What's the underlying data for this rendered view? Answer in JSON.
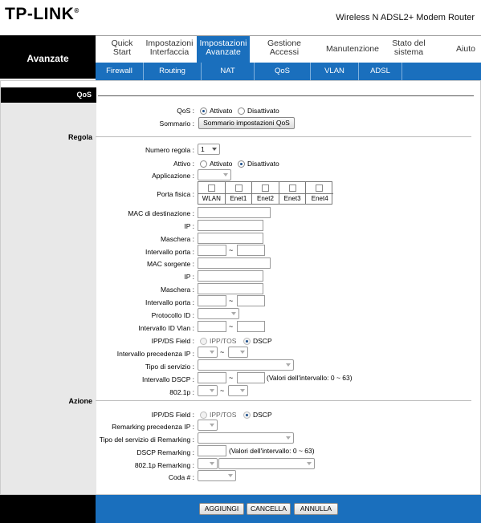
{
  "header": {
    "logo_text": "TP-LINK",
    "logo_mark": "®",
    "model": "Wireless N ADSL2+ Modem Router"
  },
  "left_section": {
    "label": "Avanzate"
  },
  "menu": {
    "items": [
      {
        "line1": "Quick",
        "line2": "Start"
      },
      {
        "line1": "Impostazioni",
        "line2": "Interfaccia"
      },
      {
        "line1": "Impostazioni",
        "line2": "Avanzate"
      },
      {
        "line1": "Gestione",
        "line2": "Accessi"
      },
      {
        "line1": "Manutenzione",
        "line2": ""
      },
      {
        "line1": "Stato del",
        "line2": "sistema"
      },
      {
        "line1": "Aiuto",
        "line2": ""
      }
    ],
    "active": "Impostazioni Avanzate"
  },
  "submenu": {
    "items": [
      "Firewall",
      "Routing",
      "NAT",
      "QoS",
      "VLAN",
      "ADSL"
    ],
    "active": "QoS"
  },
  "qos_section": {
    "title": "QoS",
    "qos_label": "QoS :",
    "qos_on": "Attivato",
    "qos_off": "Disattivato",
    "qos_value": "Attivato",
    "summary_label": "Sommario :",
    "summary_button": "Sommario impostazioni QoS"
  },
  "rule_section": {
    "title": "Regola",
    "rule_number_label": "Numero regola :",
    "rule_number_value": "1",
    "active_label": "Attivo :",
    "active_on": "Attivato",
    "active_off": "Disattivato",
    "active_value": "Disattivato",
    "application_label": "Applicazione :",
    "physical_port_label": "Porta fisica :",
    "ports": [
      "WLAN",
      "Enet1",
      "Enet2",
      "Enet3",
      "Enet4"
    ],
    "dest_mac_label": "MAC di destinazione :",
    "ip_label": "IP :",
    "mask_label": "Maschera :",
    "port_range_label": "Intervallo porta :",
    "src_mac_label": "MAC sorgente :",
    "ip2_label": "IP :",
    "mask2_label": "Maschera :",
    "port_range2_label": "Intervallo porta :",
    "protocol_label": "Protocollo ID :",
    "vlan_range_label": "Intervallo ID Vlan :",
    "ippds_label": "IPP/DS Field :",
    "ipptos": "IPP/TOS",
    "dscp": "DSCP",
    "ipp_range_label": "Intervallo precedenza IP :",
    "tos_label": "Tipo di servizio :",
    "dscp_range_label": "Intervallo DSCP :",
    "dscp_range_note": "(Valori dell'intervallo: 0 ~ 63)",
    "p8021_label": "802.1p :",
    "tilde": "~"
  },
  "action_section": {
    "title": "Azione",
    "ippds_label": "IPP/DS Field :",
    "ipptos": "IPP/TOS",
    "dscp": "DSCP",
    "remark_prec_label": "Remarking precedenza IP :",
    "remark_tos_label": "Tipo del servizio di Remarking :",
    "dscp_remark_label": "DSCP Remarking :",
    "dscp_remark_note": "(Valori dell'intervallo: 0 ~ 63)",
    "p8021_remark_label": "802.1p Remarking :",
    "queue_label": "Coda # :"
  },
  "buttons": {
    "add": "AGGIUNGI",
    "delete": "CANCELLA",
    "cancel": "ANNULLA"
  }
}
